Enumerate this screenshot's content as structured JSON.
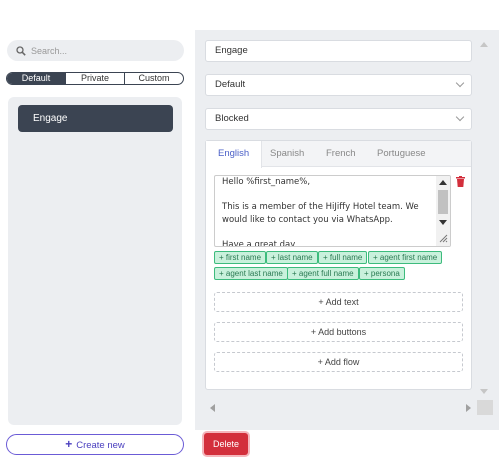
{
  "search": {
    "placeholder": "Search..."
  },
  "segments": {
    "default": "Default",
    "private": "Private",
    "custom": "Custom"
  },
  "template_list": {
    "items": [
      {
        "label": "Engage"
      }
    ]
  },
  "form": {
    "name_value": "Engage",
    "category_value": "Default",
    "status_value": "Blocked"
  },
  "language_tabs": {
    "english": "English",
    "spanish": "Spanish",
    "french": "French",
    "portuguese": "Portuguese"
  },
  "message": {
    "body": "Hello %first_name%,\n\nThis is a member of the HiJiffy Hotel team. We would like to contact you via WhatsApp.\n\nHave a great day"
  },
  "variables": {
    "first_name": "+ first name",
    "last_name": "+ last name",
    "full_name": "+ full name",
    "agent_first_name": "+ agent first name",
    "agent_last_name": "+ agent last name",
    "agent_full_name": "+ agent full name",
    "persona": "+ persona"
  },
  "actions": {
    "add_text": "+ Add text",
    "add_buttons": "+ Add buttons",
    "add_flow": "+ Add flow"
  },
  "footer": {
    "create_new": "Create new",
    "create_icon": "+",
    "delete": "Delete"
  },
  "colors": {
    "primary_dark": "#3b4452",
    "accent": "#4a5fc7",
    "tag_bg": "#c9f1dc",
    "tag_border": "#3dbb7d",
    "danger": "#d32f3c"
  }
}
